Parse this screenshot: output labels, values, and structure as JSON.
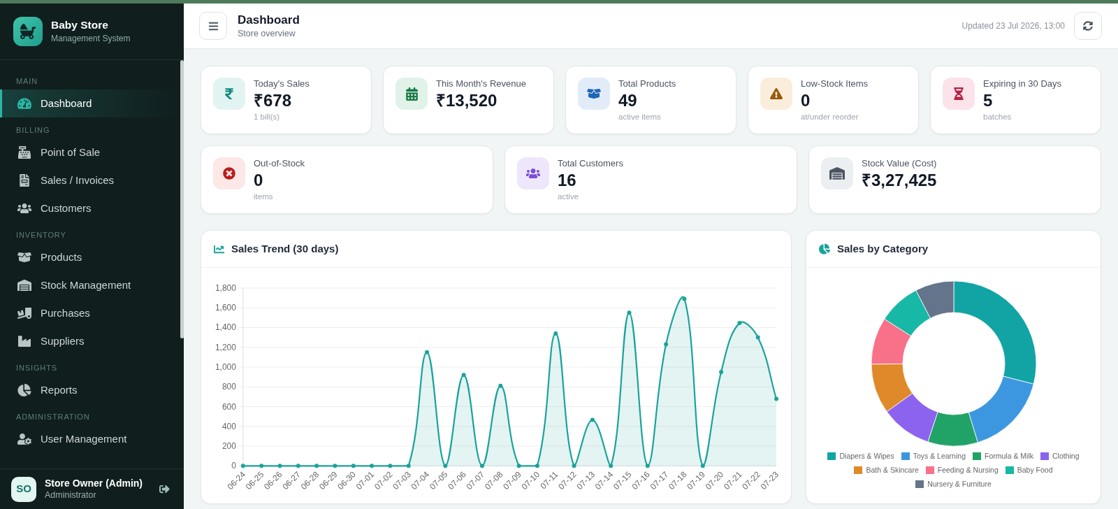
{
  "sidebar": {
    "brand": {
      "title": "Baby Store",
      "subtitle": "Management System"
    },
    "sections": [
      {
        "label": "MAIN",
        "items": [
          {
            "label": "Dashboard",
            "selected": true
          }
        ]
      },
      {
        "label": "BILLING",
        "items": [
          {
            "label": "Point of Sale",
            "selected": false
          },
          {
            "label": "Sales / Invoices",
            "selected": false
          },
          {
            "label": "Customers",
            "selected": false
          }
        ]
      },
      {
        "label": "INVENTORY",
        "items": [
          {
            "label": "Products",
            "selected": false
          },
          {
            "label": "Stock Management",
            "selected": false
          },
          {
            "label": "Purchases",
            "selected": false
          },
          {
            "label": "Suppliers",
            "selected": false
          }
        ]
      },
      {
        "label": "INSIGHTS",
        "items": [
          {
            "label": "Reports",
            "selected": false
          }
        ]
      },
      {
        "label": "ADMINISTRATION",
        "items": [
          {
            "label": "User Management",
            "selected": false
          }
        ]
      }
    ],
    "user": {
      "initials": "SO",
      "name": "Store Owner (Admin)",
      "role": "Administrator"
    }
  },
  "header": {
    "title": "Dashboard",
    "subtitle": "Store overview",
    "updated": "Updated 23 Jul 2026, 13:00"
  },
  "stats_row_1": [
    {
      "label": "Today's Sales",
      "value": "₹678",
      "note": "1 bill(s)"
    },
    {
      "label": "This Month's Revenue",
      "value": "₹13,520"
    },
    {
      "label": "Total Products",
      "value": "49",
      "note": "active items"
    },
    {
      "label": "Low-Stock Items",
      "value": "0",
      "note": "at/under reorder"
    },
    {
      "label": "Expiring in 30 Days",
      "value": "5",
      "note": "batches"
    }
  ],
  "stats_row_2": [
    {
      "label": "Out-of-Stock",
      "value": "0",
      "note": "items"
    },
    {
      "label": "Total Customers",
      "value": "16",
      "note": "active"
    },
    {
      "label": "Stock Value (Cost)",
      "value": "₹3,27,425"
    }
  ],
  "sales_trend": {
    "title": "Sales Trend (30 days)",
    "chart_data": {
      "type": "area",
      "grid": true,
      "marker": true,
      "categories": [
        "06-24",
        "06-25",
        "06-26",
        "06-27",
        "06-28",
        "06-29",
        "06-30",
        "07-01",
        "07-02",
        "07-03",
        "07-04",
        "07-05",
        "07-06",
        "07-07",
        "07-08",
        "07-09",
        "07-10",
        "07-11",
        "07-12",
        "07-13",
        "07-14",
        "07-15",
        "07-16",
        "07-17",
        "07-18",
        "07-19",
        "07-20",
        "07-21",
        "07-22",
        "07-23"
      ],
      "values": [
        0,
        0,
        0,
        0,
        0,
        0,
        0,
        0,
        0,
        0,
        1150,
        0,
        920,
        0,
        810,
        0,
        0,
        1340,
        0,
        465,
        0,
        1550,
        0,
        1230,
        1690,
        0,
        950,
        1445,
        1300,
        678
      ],
      "ylim": [
        0,
        1800
      ],
      "yticks": [
        {
          "value": 0,
          "label": "0"
        },
        {
          "value": 200,
          "label": "200"
        },
        {
          "value": 400,
          "label": "400"
        },
        {
          "value": 600,
          "label": "600"
        },
        {
          "value": 800,
          "label": "800"
        },
        {
          "value": 1000,
          "label": "1,000"
        },
        {
          "value": 1200,
          "label": "1,200"
        },
        {
          "value": 1400,
          "label": "1,400"
        },
        {
          "value": 1600,
          "label": "1,600"
        },
        {
          "value": 1800,
          "label": "1,800"
        }
      ]
    }
  },
  "sales_by_category": {
    "title": "Sales by Category",
    "legend": [
      {
        "label": "Diapers & Wipes",
        "color": "#12a4a4"
      },
      {
        "label": "Toys & Learning",
        "color": "#3d97e0"
      },
      {
        "label": "Formula & Milk",
        "color": "#21a266"
      },
      {
        "label": "Clothing",
        "color": "#8b63ef"
      },
      {
        "label": "Bath & Skincare",
        "color": "#df892b"
      },
      {
        "label": "Feeding & Nursing",
        "color": "#f87189"
      },
      {
        "label": "Baby Food",
        "color": "#17b8a5"
      },
      {
        "label": "Nursery & Furniture",
        "color": "#64748b"
      }
    ]
  }
}
